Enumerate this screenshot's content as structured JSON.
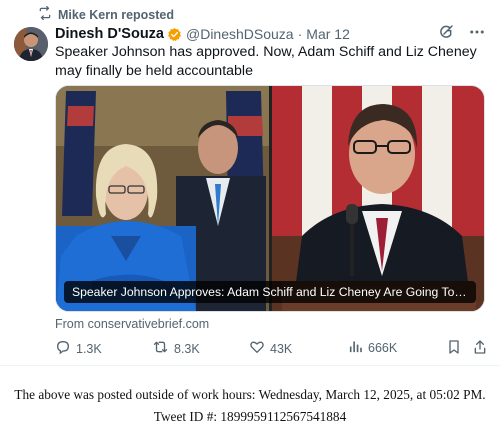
{
  "tweet": {
    "repost_by": "Mike Kern reposted",
    "author_name": "Dinesh D'Souza",
    "author_handle": "@DineshDSouza",
    "separator": "·",
    "date": "Mar 12",
    "text": "Speaker Johnson has approved. Now, Adam Schiff and Liz Cheney may finally be held accountable",
    "card_title": "Speaker Johnson Approves: Adam Schiff and Liz Cheney Are Going To Be ...",
    "card_source": "From conservativebrief.com",
    "replies": "1.3K",
    "reposts": "8.3K",
    "likes": "43K",
    "views": "666K"
  },
  "icons": {
    "repost": "repost-icon",
    "verified": "verified-badge-icon",
    "grok": "grok-icon",
    "more": "more-icon",
    "reply": "reply-icon",
    "like": "heart-icon",
    "views": "views-chart-icon",
    "bookmark": "bookmark-icon",
    "share": "share-icon"
  },
  "colors": {
    "text": "#0f1419",
    "secondary": "#536471",
    "verified_badge": "#f6a000",
    "card_border": "#dbe1e4"
  },
  "footer": {
    "line1": "The above was posted outside of work hours: Wednesday, March 12, 2025, at 05:02 PM.",
    "line2": "Tweet ID #: 1899959112567541884"
  }
}
